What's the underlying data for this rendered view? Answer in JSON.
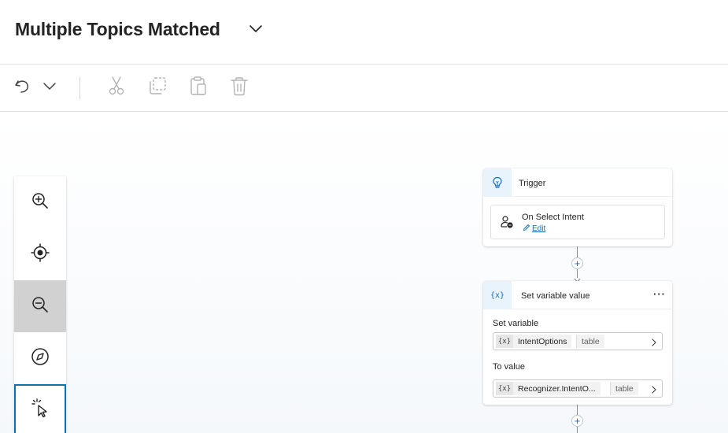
{
  "header": {
    "title": "Multiple Topics Matched",
    "title_menu_icon": "chevron-down-icon"
  },
  "toolbar": {
    "undo_icon": "undo-icon",
    "undo_menu_icon": "chevron-down-icon",
    "actions": [
      {
        "name": "cut",
        "icon": "scissors-icon",
        "enabled": false
      },
      {
        "name": "copy",
        "icon": "copy-icon",
        "enabled": false
      },
      {
        "name": "paste",
        "icon": "clipboard-icon",
        "enabled": false
      },
      {
        "name": "delete",
        "icon": "trash-icon",
        "enabled": false
      }
    ]
  },
  "zoom_panel": {
    "buttons": [
      {
        "name": "zoom-in",
        "icon": "zoom-in-icon"
      },
      {
        "name": "recenter",
        "icon": "crosshair-icon"
      },
      {
        "name": "zoom-out",
        "icon": "zoom-out-icon",
        "state": "active"
      },
      {
        "name": "minimap",
        "icon": "compass-icon"
      },
      {
        "name": "select-mode",
        "icon": "cursor-click-icon",
        "state": "selected"
      }
    ]
  },
  "trigger_node": {
    "icon": "lightbulb-icon",
    "title": "Trigger",
    "intent_icon": "person-chat-icon",
    "intent_label": "On Select Intent",
    "edit_label": "Edit"
  },
  "set_variable_node": {
    "icon_text": "{x}",
    "title": "Set variable value",
    "more_label": "···",
    "set_variable_label": "Set variable",
    "variable": {
      "icon_text": "{x}",
      "name": "IntentOptions",
      "type": "table"
    },
    "to_value_label": "To value",
    "value": {
      "icon_text": "{x}",
      "name": "Recognizer.IntentO...",
      "type": "table"
    }
  },
  "connectors": {
    "add_label": "+"
  },
  "colors": {
    "accent": "#0f6cbd",
    "node_icon_bg": "#e8f3fc",
    "active_button": "#d1d1d1"
  }
}
